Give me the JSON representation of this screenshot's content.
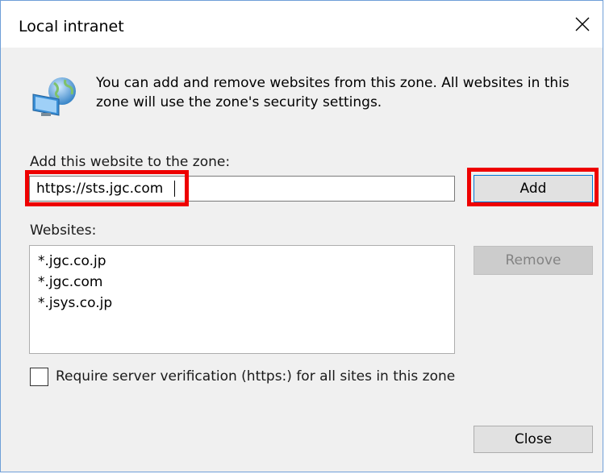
{
  "window": {
    "title": "Local intranet"
  },
  "info": {
    "text": "You can add and remove websites from this zone. All websites in this zone will use the zone's security settings.",
    "icon": "globe-monitor-icon"
  },
  "add_section": {
    "label": "Add this website to the zone:",
    "input_value": "https://sts.jgc.com",
    "add_button": "Add"
  },
  "websites": {
    "label": "Websites:",
    "items": [
      "*.jgc.co.jp",
      "*.jgc.com",
      "*.jsys.co.jp"
    ],
    "remove_button": "Remove"
  },
  "options": {
    "require_https_label": "Require server verification (https:) for all sites in this zone",
    "require_https_checked": false
  },
  "footer": {
    "close_button": "Close"
  },
  "colors": {
    "highlight": "#ee0000",
    "focus_border": "#0078d7"
  }
}
